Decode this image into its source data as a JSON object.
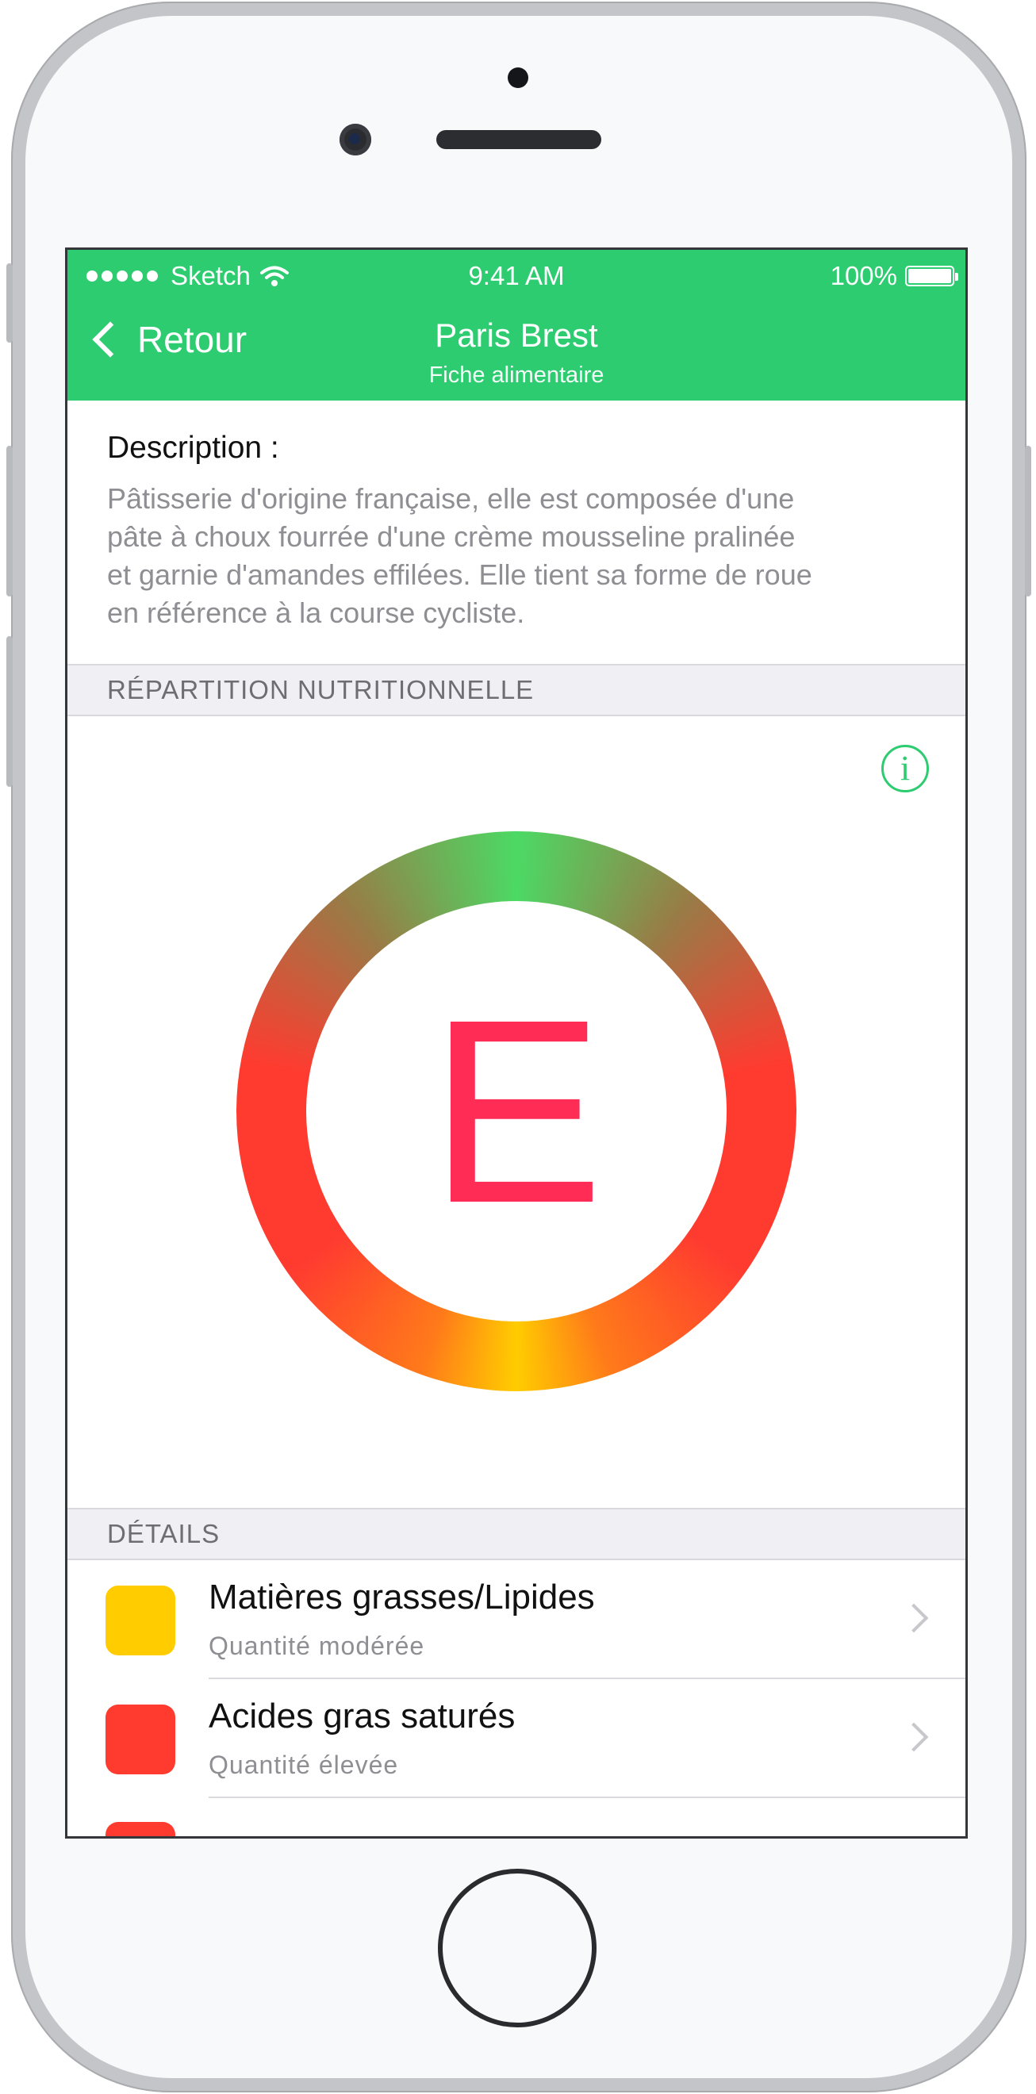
{
  "status_bar": {
    "carrier": "Sketch",
    "time": "9:41 AM",
    "battery": "100%"
  },
  "nav": {
    "back_label": "Retour",
    "title": "Paris Brest",
    "subtitle": "Fiche alimentaire"
  },
  "description": {
    "title": "Description :",
    "lines": [
      "Pâtisserie d'origine française, elle est composée d'une",
      "pâte à choux fourrée d'une crème mousseline pralinée",
      "et garnie d'amandes effilées. Elle tient sa forme de roue",
      "en référence à la course cycliste."
    ]
  },
  "sections": {
    "nutrition_header": "RÉPARTITION NUTRITIONNELLE",
    "details_header": "DÉTAILS"
  },
  "nutrition": {
    "info_symbol": "i",
    "grade": "E",
    "grade_color": "#ff2d55"
  },
  "details": [
    {
      "label": "Matières grasses/Lipides",
      "level": "Quantité modérée",
      "color": "#ffcc00"
    },
    {
      "label": "Acides gras saturés",
      "level": "Quantité élevée",
      "color": "#ff3b30"
    },
    {
      "label": "",
      "level": "",
      "color": "#ff3b30"
    }
  ],
  "colors": {
    "accent": "#2ecc71",
    "low": "#4cd964",
    "moderate": "#ffcc00",
    "high": "#ff3b30"
  }
}
